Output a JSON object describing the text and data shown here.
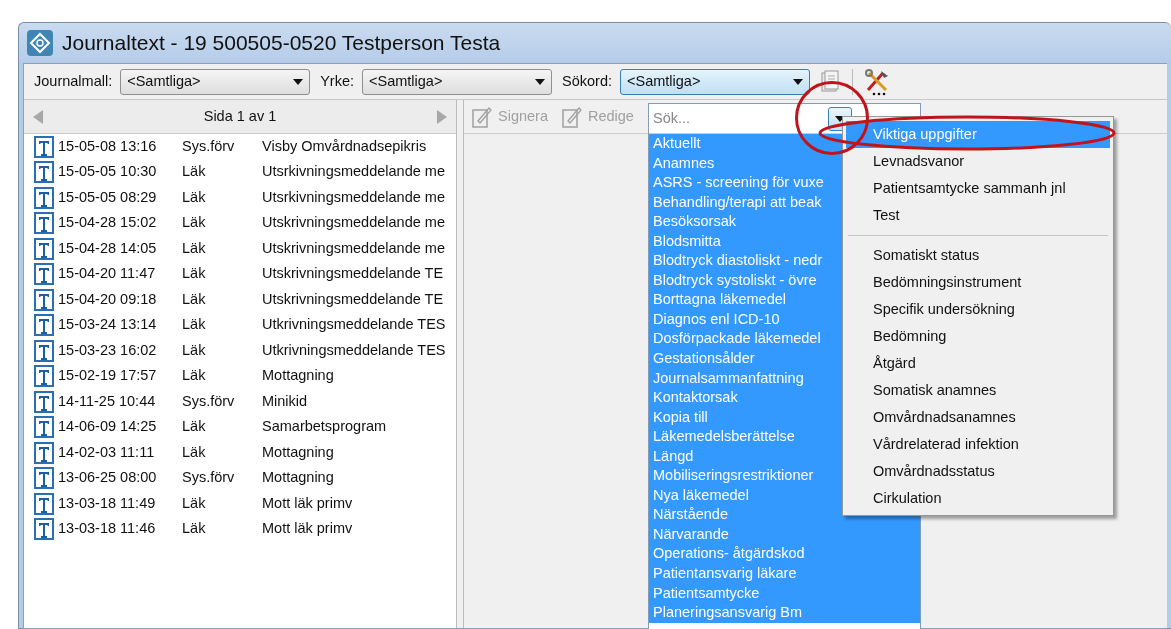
{
  "window": {
    "title": "Journaltext  -  19 500505-0520 Testperson Testa"
  },
  "filters": [
    {
      "label": "Journalmall:",
      "value": "<Samtliga>",
      "open": false
    },
    {
      "label": "Yrke:",
      "value": "<Samtliga>",
      "open": false
    },
    {
      "label": "Sökord:",
      "value": "<Samtliga>",
      "open": true
    }
  ],
  "pager": {
    "text": "Sida 1 av 1"
  },
  "entries": [
    {
      "date": "15-05-08 13:16",
      "role": "Sys.förv",
      "title": "Visby Omvårdnadsepikris"
    },
    {
      "date": "15-05-05 10:30",
      "role": "Läk",
      "title": "Utsrkivningsmeddelande me"
    },
    {
      "date": "15-05-05 08:29",
      "role": "Läk",
      "title": "Utsrkivningsmeddelande me"
    },
    {
      "date": "15-04-28 15:02",
      "role": "Läk",
      "title": "Utskrivningsmeddelande me"
    },
    {
      "date": "15-04-28 14:05",
      "role": "Läk",
      "title": "Utskrivningsmeddelande me"
    },
    {
      "date": "15-04-20 11:47",
      "role": "Läk",
      "title": "Utskrivningsmeddelande TE"
    },
    {
      "date": "15-04-20 09:18",
      "role": "Läk",
      "title": "Utskrivningsmeddelande TE"
    },
    {
      "date": "15-03-24 13:14",
      "role": "Läk",
      "title": "Utkrivningsmeddelande TES"
    },
    {
      "date": "15-03-23 16:02",
      "role": "Läk",
      "title": "Utkrivningsmeddelande TES"
    },
    {
      "date": "15-02-19 17:57",
      "role": "Läk",
      "title": "Mottagning"
    },
    {
      "date": "14-11-25 10:44",
      "role": "Sys.förv",
      "title": "Minikid"
    },
    {
      "date": "14-06-09 14:25",
      "role": "Läk",
      "title": "Samarbetsprogram"
    },
    {
      "date": "14-02-03 11:11",
      "role": "Läk",
      "title": "Mottagning"
    },
    {
      "date": "13-06-25 08:00",
      "role": "Sys.förv",
      "title": "Mottagning"
    },
    {
      "date": "13-03-18 11:49",
      "role": "Läk",
      "title": "Mott läk primv"
    },
    {
      "date": "13-03-18 11:46",
      "role": "Läk",
      "title": "Mott läk primv"
    }
  ],
  "editor_toolbar": [
    {
      "label": "Signera",
      "disabled": true
    },
    {
      "label": "Redige",
      "disabled": true
    }
  ],
  "keyword_popup": {
    "placeholder": "Sök...",
    "items": [
      {
        "label": "Aktuellt",
        "selected": true
      },
      {
        "label": "Anamnes",
        "selected": true
      },
      {
        "label": "ASRS - screening för vuxe",
        "selected": true
      },
      {
        "label": "Behandling/terapi att beak",
        "selected": true
      },
      {
        "label": "Besöksorsak",
        "selected": true
      },
      {
        "label": "Blodsmitta",
        "selected": true
      },
      {
        "label": "Blodtryck diastoliskt - nedr",
        "selected": true
      },
      {
        "label": "Blodtryck systoliskt - övre",
        "selected": true
      },
      {
        "label": "Borttagna läkemedel",
        "selected": true
      },
      {
        "label": "Diagnos enl ICD-10",
        "selected": true
      },
      {
        "label": "Dosförpackade läkemedel",
        "selected": true
      },
      {
        "label": "Gestationsålder",
        "selected": true
      },
      {
        "label": "Journalsammanfattning",
        "selected": true
      },
      {
        "label": "Kontaktorsak",
        "selected": true
      },
      {
        "label": "Kopia till",
        "selected": true
      },
      {
        "label": "Läkemedelsberättelse",
        "selected": true
      },
      {
        "label": "Längd",
        "selected": true
      },
      {
        "label": "Mobiliseringsrestriktioner",
        "selected": true
      },
      {
        "label": "Nya läkemedel",
        "selected": true
      },
      {
        "label": "Närstående",
        "selected": true
      },
      {
        "label": "Närvarande",
        "selected": true
      },
      {
        "label": "Operations- åtgärdskod",
        "selected": true
      },
      {
        "label": "Patientansvarig läkare",
        "selected": true
      },
      {
        "label": "Patientsamtycke",
        "selected": true
      },
      {
        "label": "Planeringsansvarig Bm",
        "selected": true
      }
    ]
  },
  "menu": {
    "groups": [
      {
        "items": [
          {
            "label": "Viktiga uppgifter",
            "selected": true
          },
          {
            "label": "Levnadsvanor",
            "selected": false
          },
          {
            "label": "Patientsamtycke sammanh jnl",
            "selected": false
          },
          {
            "label": "Test",
            "selected": false
          }
        ]
      },
      {
        "items": [
          {
            "label": "Somatiskt status",
            "selected": false
          },
          {
            "label": "Bedömningsinstrument",
            "selected": false
          },
          {
            "label": "Specifik undersökning",
            "selected": false
          },
          {
            "label": "Bedömning",
            "selected": false
          },
          {
            "label": "Åtgärd",
            "selected": false
          },
          {
            "label": "Somatisk anamnes",
            "selected": false
          },
          {
            "label": "Omvårdnadsanamnes",
            "selected": false
          },
          {
            "label": "Vårdrelaterad infektion",
            "selected": false
          },
          {
            "label": "Omvårdnadsstatus",
            "selected": false
          },
          {
            "label": "Cirkulation",
            "selected": false
          }
        ]
      }
    ]
  }
}
